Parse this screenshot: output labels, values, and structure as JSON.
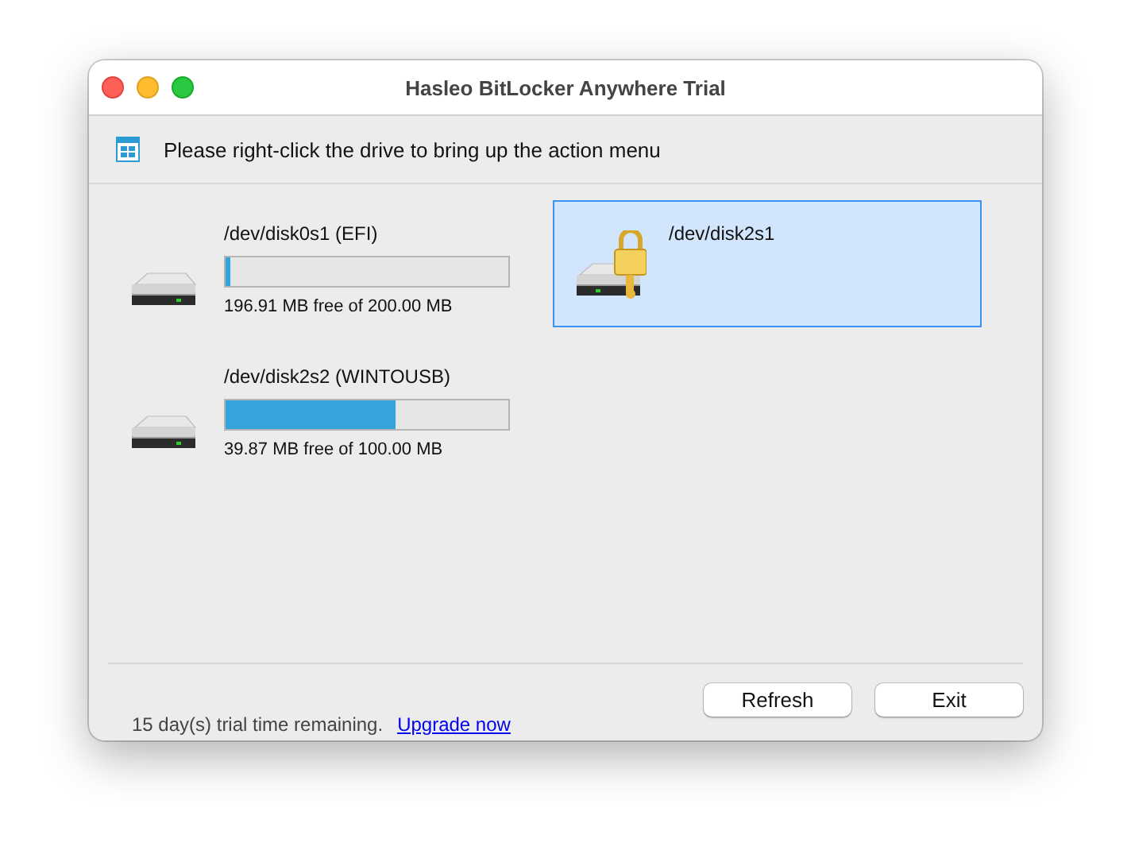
{
  "window": {
    "title": "Hasleo BitLocker Anywhere Trial"
  },
  "hint": "Please right-click the drive to bring up the action menu",
  "drives": [
    {
      "kind": "volume",
      "name": "/dev/disk0s1 (EFI)",
      "level": 0.015,
      "free": "196.91 MB free of 200.00 MB",
      "selected": false
    },
    {
      "kind": "locked",
      "name": "/dev/disk2s1",
      "selected": true
    },
    {
      "kind": "volume",
      "name": "/dev/disk2s2 (WINTOUSB)",
      "level": 0.6,
      "free": "39.87 MB free of 100.00 MB",
      "selected": false
    }
  ],
  "footer": {
    "trial": "15 day(s) trial time remaining.",
    "link": "Upgrade now"
  },
  "buttons": [
    "Refresh",
    "Exit"
  ]
}
